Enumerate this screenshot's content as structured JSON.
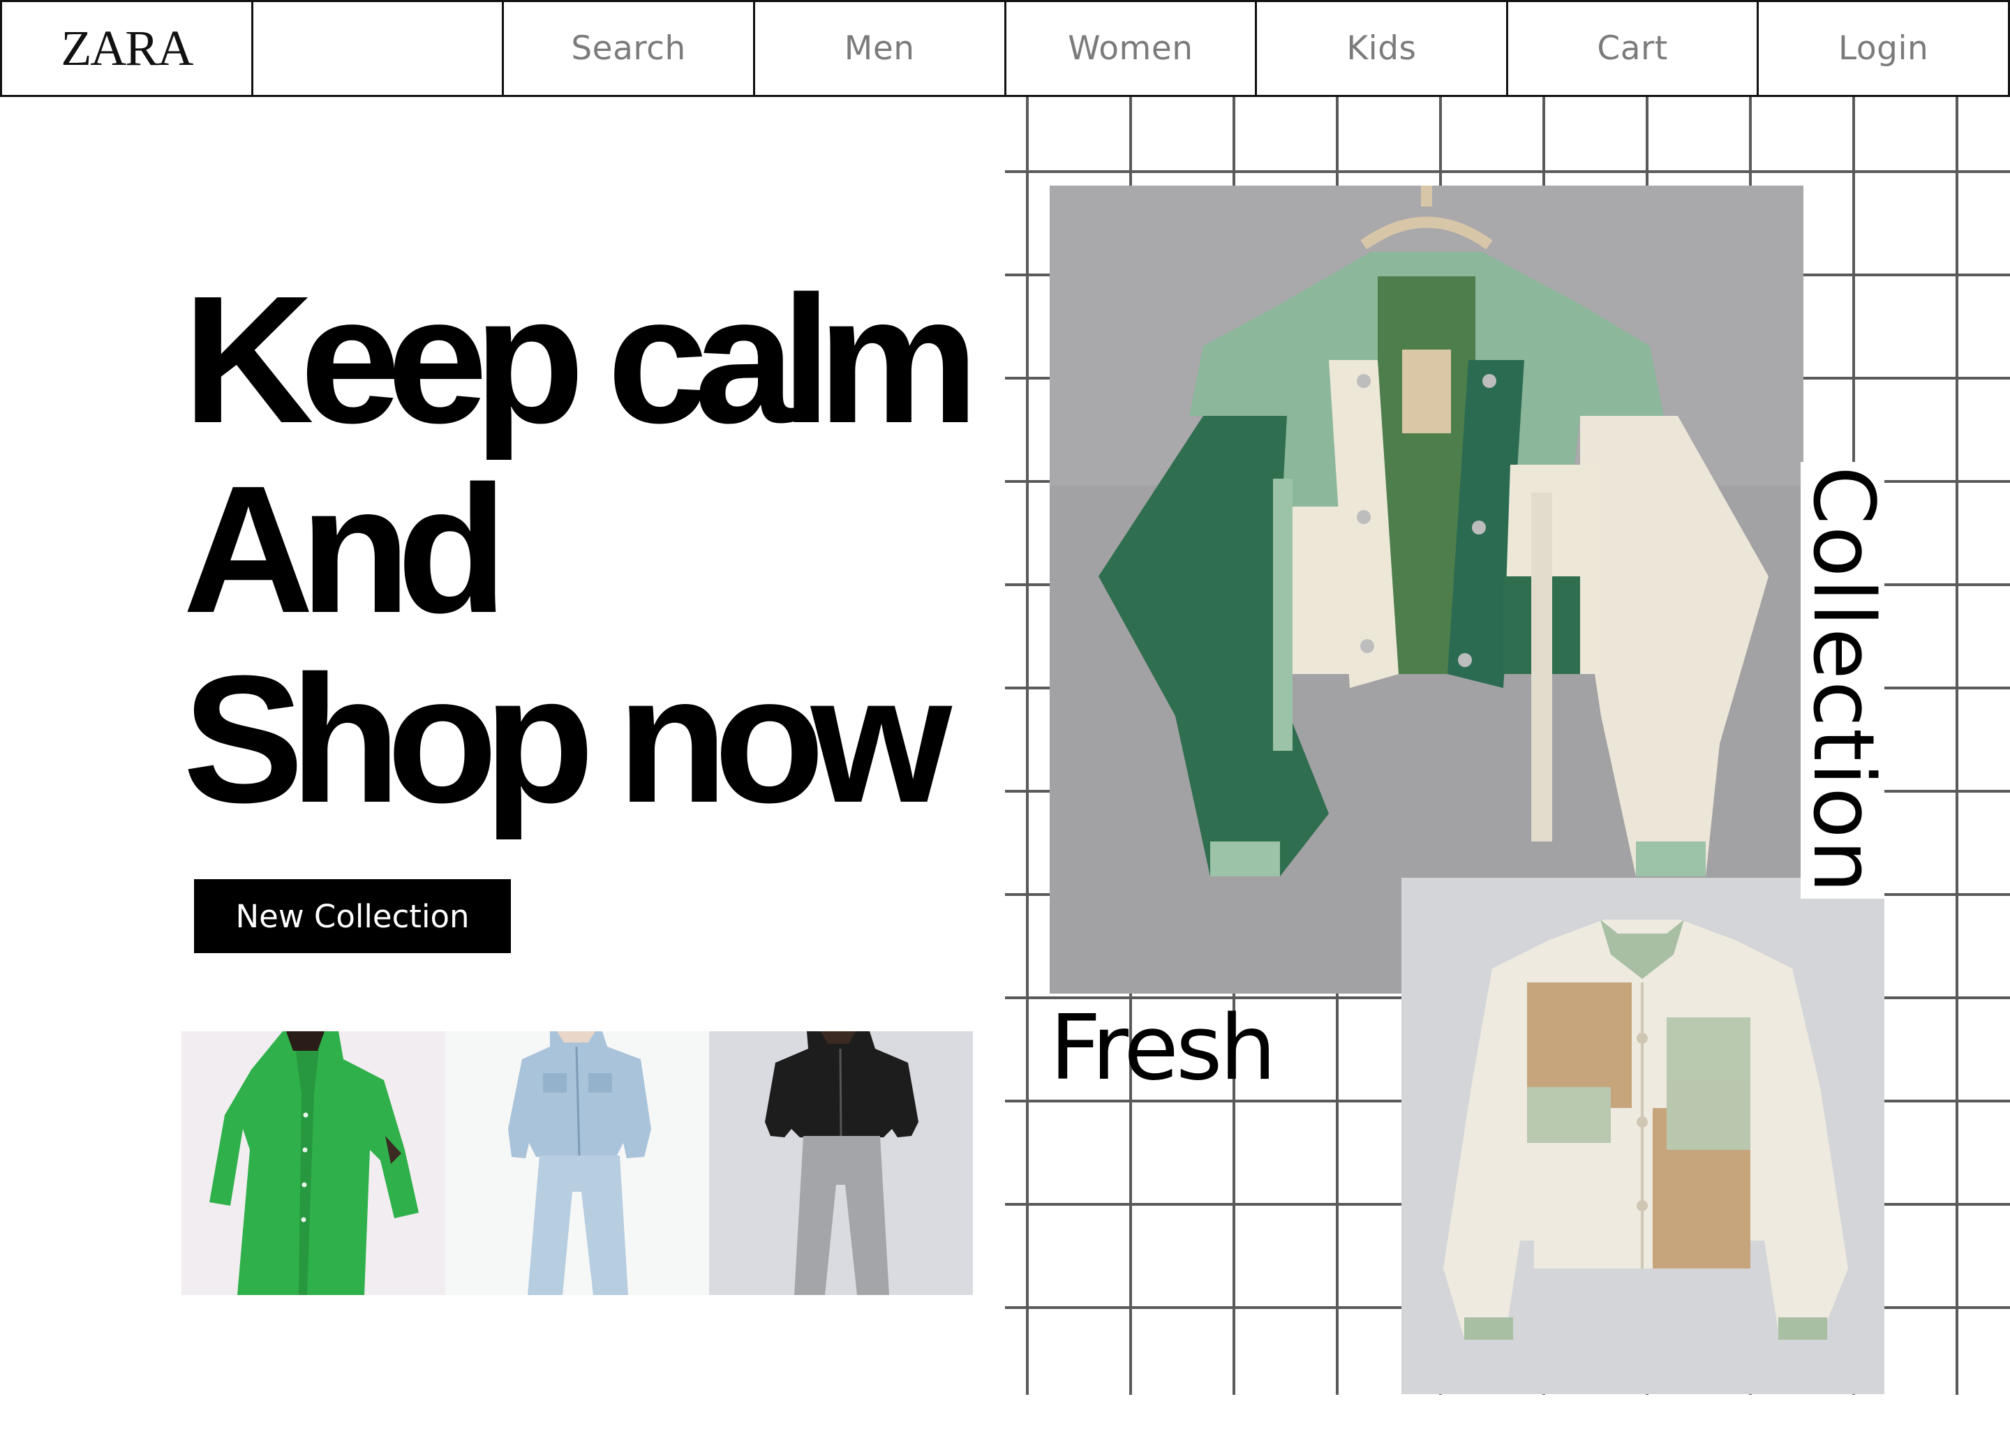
{
  "nav": {
    "logo": "ZARA",
    "items": [
      "Search",
      "Men",
      "Women",
      "Kids",
      "Cart",
      "Login"
    ]
  },
  "hero": {
    "headline_lines": [
      "Keep calm",
      "And",
      "Shop now"
    ],
    "cta_label": "New Collection",
    "side_word_vertical": "Collection",
    "side_word_horizontal": "Fresh"
  },
  "thumbnails": [
    {
      "icon": "green-shirt-dress-image",
      "color": "#2fb04a"
    },
    {
      "icon": "denim-set-image",
      "color": "#a9c3da"
    },
    {
      "icon": "black-jacket-jeans-image",
      "color": "#1d1d1d"
    }
  ],
  "featured": [
    {
      "icon": "green-patchwork-jacket-image",
      "color": "#2f6e4e"
    },
    {
      "icon": "cream-patchwork-jacket-image",
      "color": "#c7a57c"
    }
  ],
  "colors": {
    "border": "#111111",
    "nav_text": "#7b7b7b",
    "cta_bg": "#000000",
    "grid_line": "#5a5a5a"
  }
}
